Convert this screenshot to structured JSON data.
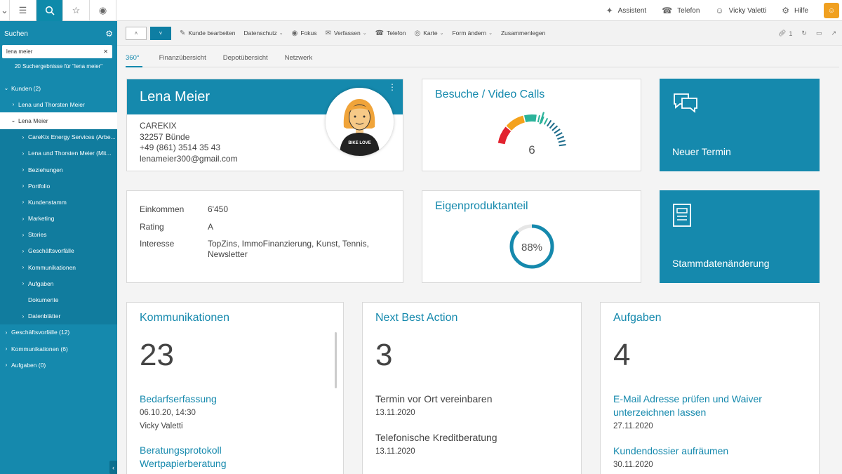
{
  "topbar": {
    "right_items": [
      {
        "icon": "assistant-icon",
        "glyph": "✦",
        "label": "Assistent"
      },
      {
        "icon": "phone-icon",
        "glyph": "☎",
        "label": "Telefon"
      },
      {
        "icon": "user-icon",
        "glyph": "☺",
        "label": "Vicky Valetti"
      },
      {
        "icon": "help-icon",
        "glyph": "⚙",
        "label": "Hilfe"
      }
    ]
  },
  "sidebar": {
    "title": "Suchen",
    "search_value": "lena meier",
    "result_text": "20 Suchergebnisse für \"lena meier\"",
    "tree": [
      {
        "label": "Kunden (2)",
        "level": 0,
        "open": true
      },
      {
        "label": "Lena und Thorsten Meier",
        "level": 1,
        "open": false
      },
      {
        "label": "Lena Meier",
        "level": 1,
        "open": true,
        "selected": true
      },
      {
        "label": "CareKix Energy Services (Arbe...",
        "level": 2,
        "open": false
      },
      {
        "label": "Lena und Thorsten Meier (Mit...",
        "level": 2,
        "open": false
      },
      {
        "label": "Beziehungen",
        "level": 2,
        "open": false
      },
      {
        "label": "Portfolio",
        "level": 2,
        "open": false
      },
      {
        "label": "Kundenstamm",
        "level": 2,
        "open": false
      },
      {
        "label": "Marketing",
        "level": 2,
        "open": false
      },
      {
        "label": "Stories",
        "level": 2,
        "open": false
      },
      {
        "label": "Geschäftsvorfälle",
        "level": 2,
        "open": false
      },
      {
        "label": "Kommunikationen",
        "level": 2,
        "open": false
      },
      {
        "label": "Aufgaben",
        "level": 2,
        "open": false
      },
      {
        "label": "Dokumente",
        "level": 2,
        "leaf": true
      },
      {
        "label": "Datenblätter",
        "level": 2,
        "open": false
      },
      {
        "label": "Geschäftsvorfälle (12)",
        "level": 0,
        "open": false
      },
      {
        "label": "Kommunikationen (6)",
        "level": 0,
        "open": false
      },
      {
        "label": "Aufgaben (0)",
        "level": 0,
        "open": false
      }
    ]
  },
  "toolbar": {
    "items": [
      {
        "icon": "edit-icon",
        "glyph": "✎",
        "label": "Kunde bearbeiten",
        "dropdown": false
      },
      {
        "icon": "",
        "glyph": "",
        "label": "Datenschutz",
        "dropdown": true
      },
      {
        "icon": "focus-icon",
        "glyph": "◉",
        "label": "Fokus",
        "dropdown": false
      },
      {
        "icon": "mail-icon",
        "glyph": "✉",
        "label": "Verfassen",
        "dropdown": true
      },
      {
        "icon": "phone-icon",
        "glyph": "☎",
        "label": "Telefon",
        "dropdown": false
      },
      {
        "icon": "globe-icon",
        "glyph": "◎",
        "label": "Karte",
        "dropdown": true
      },
      {
        "icon": "",
        "glyph": "",
        "label": "Form ändern",
        "dropdown": true
      },
      {
        "icon": "",
        "glyph": "",
        "label": "Zusammenlegen",
        "dropdown": false
      }
    ],
    "link_count": "1"
  },
  "tabs": [
    "360°",
    "Finanzübersicht",
    "Depotübersicht",
    "Netzwerk"
  ],
  "profile": {
    "name": "Lena Meier",
    "company": "CAREKIX",
    "city": "32257 Bünde",
    "phone": "+49 (861) 3514 35 43",
    "email": "lenameier300@gmail.com",
    "shirt_text": "BIKE LOVE"
  },
  "visits": {
    "title": "Besuche / Video Calls",
    "value": "6",
    "gauge_level": 0.6
  },
  "tiles": {
    "termin": "Neuer Termin",
    "stamm": "Stammdatenänderung"
  },
  "details": {
    "rows": [
      {
        "key": "Einkommen",
        "value": "6'450"
      },
      {
        "key": "Rating",
        "value": "A"
      },
      {
        "key": "Interesse",
        "value": "TopZins, ImmoFinanzierung, Kunst, Tennis, Newsletter"
      }
    ]
  },
  "eigen": {
    "title": "Eigenproduktanteil",
    "value_label": "88%",
    "fraction": 0.88
  },
  "kommunikationen": {
    "title": "Kommunikationen",
    "count": "23",
    "items": [
      {
        "title": "Bedarfserfassung",
        "lines": [
          "06.10.20, 14:30",
          "Vicky Valetti"
        ]
      },
      {
        "title": "Beratungsprotokoll Wertpapierberatung",
        "lines": []
      }
    ]
  },
  "nba": {
    "title": "Next Best Action",
    "count": "3",
    "items": [
      {
        "title": "Termin vor Ort vereinbaren",
        "lines": [
          "13.11.2020"
        ]
      },
      {
        "title": "Telefonische Kreditberatung",
        "lines": [
          "13.11.2020"
        ]
      }
    ]
  },
  "aufgaben": {
    "title": "Aufgaben",
    "count": "4",
    "items": [
      {
        "title": "E-Mail Adresse prüfen und Waiver unterzeichnen lassen",
        "lines": [
          "27.11.2020"
        ]
      },
      {
        "title": "Kundendossier aufräumen",
        "lines": [
          "30.11.2020"
        ]
      }
    ]
  },
  "colors": {
    "accent": "#1589ad",
    "gauge_red": "#e2222e",
    "gauge_orange": "#f4a21c",
    "gauge_green": "#2bb39a",
    "gauge_dark": "#1b6a8a"
  }
}
